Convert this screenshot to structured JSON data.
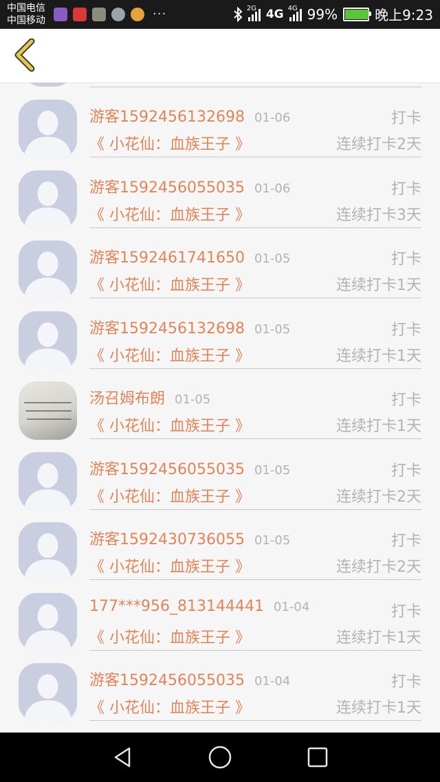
{
  "status_bar": {
    "carrier_1": "中国电信",
    "carrier_2": "中国移动",
    "more": "···",
    "net_2g": "2G",
    "net_4g_a": "4G",
    "net_4g_b": "4G",
    "battery": "99%",
    "battery_level": 0.99,
    "time": "晚上9:23"
  },
  "colors": {
    "accent": "#e0845a",
    "muted": "#b3b3b3",
    "back_arrow": "#e8c84a",
    "back_arrow_outline": "#3a3a3a"
  },
  "header": {
    "back_icon": "chevron-left-icon"
  },
  "records": [
    {
      "name": "游客1592456132698",
      "date": "01-06",
      "book": "《 小花仙：血族王子 》",
      "action": "打卡",
      "streak": "连续打卡2天",
      "avatar": "default"
    },
    {
      "name": "游客1592456055035",
      "date": "01-06",
      "book": "《 小花仙：血族王子 》",
      "action": "打卡",
      "streak": "连续打卡3天",
      "avatar": "default"
    },
    {
      "name": "游客1592461741650",
      "date": "01-05",
      "book": "《 小花仙：血族王子 》",
      "action": "打卡",
      "streak": "连续打卡1天",
      "avatar": "default"
    },
    {
      "name": "游客1592456132698",
      "date": "01-05",
      "book": "《 小花仙：血族王子 》",
      "action": "打卡",
      "streak": "连续打卡1天",
      "avatar": "default"
    },
    {
      "name": "汤召姆布朗",
      "date": "01-05",
      "book": "《 小花仙：血族王子 》",
      "action": "打卡",
      "streak": "连续打卡1天",
      "avatar": "photo"
    },
    {
      "name": "游客1592456055035",
      "date": "01-05",
      "book": "《 小花仙：血族王子 》",
      "action": "打卡",
      "streak": "连续打卡2天",
      "avatar": "default"
    },
    {
      "name": "游客1592430736055",
      "date": "01-05",
      "book": "《 小花仙：血族王子 》",
      "action": "打卡",
      "streak": "连续打卡2天",
      "avatar": "default"
    },
    {
      "name": "177***956_813144441",
      "date": "01-04",
      "book": "《 小花仙：血族王子 》",
      "action": "打卡",
      "streak": "连续打卡1天",
      "avatar": "default"
    },
    {
      "name": "游客1592456055035",
      "date": "01-04",
      "book": "《 小花仙：血族王子 》",
      "action": "打卡",
      "streak": "连续打卡1天",
      "avatar": "default"
    }
  ],
  "nav": {
    "back": "triangle-back-icon",
    "home": "circle-home-icon",
    "recents": "square-recents-icon"
  }
}
